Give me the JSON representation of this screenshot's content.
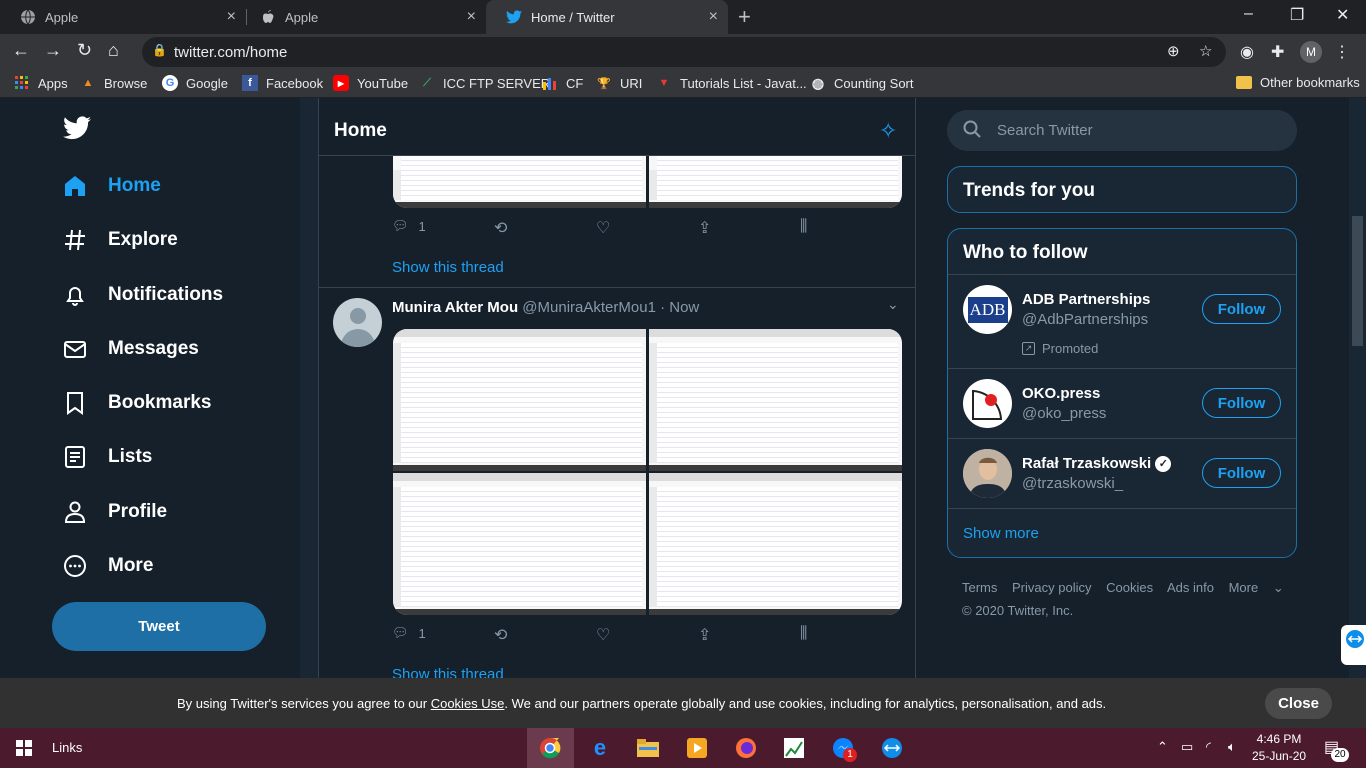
{
  "browser": {
    "tabs": [
      {
        "title": "Apple",
        "close": "×"
      },
      {
        "title": "Apple",
        "close": "×"
      },
      {
        "title": "Home / Twitter",
        "close": "×"
      }
    ],
    "new_tab": "+",
    "window_controls": {
      "minimize": "–",
      "maximize": "❐",
      "close": "✕"
    },
    "url": "twitter.com/home",
    "profile_initial": "M",
    "bookmarks": [
      "Apps",
      "Browse",
      "Google",
      "Facebook",
      "YouTube",
      "ICC FTP SERVER",
      "CF",
      "URI",
      "Tutorials List - Javat...",
      "Counting Sort"
    ],
    "other_bookmarks": "Other bookmarks"
  },
  "nav": {
    "items": [
      "Home",
      "Explore",
      "Notifications",
      "Messages",
      "Bookmarks",
      "Lists",
      "Profile",
      "More"
    ],
    "tweet_button": "Tweet"
  },
  "timeline": {
    "title": "Home",
    "tweet1": {
      "replies": "1",
      "show_thread": "Show this thread"
    },
    "tweet2": {
      "name": "Munira Akter Mou",
      "handle": "@MuniraAkterMou1",
      "separator": "·",
      "time": "Now",
      "replies": "1",
      "show_thread": "Show this thread"
    }
  },
  "sidebar": {
    "search_placeholder": "Search Twitter",
    "trends_title": "Trends for you",
    "who_to_follow_title": "Who to follow",
    "accounts": [
      {
        "name": "ADB Partnerships",
        "handle": "@AdbPartnerships",
        "promoted": "Promoted",
        "avatar_text": "ADB",
        "button": "Follow"
      },
      {
        "name": "OKO.press",
        "handle": "@oko_press",
        "button": "Follow"
      },
      {
        "name": "Rafał Trzaskowski",
        "handle": "@trzaskowski_",
        "button": "Follow"
      }
    ],
    "show_more": "Show more",
    "footer_links": [
      "Terms",
      "Privacy policy",
      "Cookies",
      "Ads info",
      "More"
    ],
    "copyright": "© 2020 Twitter, Inc."
  },
  "cookie_banner": {
    "before": "By using Twitter's services you agree to our ",
    "link": "Cookies Use",
    "after": ". We and our partners operate globally and use cookies, including for analytics, personalisation, and ads.",
    "close": "Close"
  },
  "taskbar": {
    "links": "Links",
    "time": "4:46 PM",
    "date": "25-Jun-20",
    "notifications": "20",
    "messenger_badge": "1"
  },
  "colors": {
    "accent": "#1da1f2",
    "background": "#15202b",
    "card": "#192734"
  }
}
